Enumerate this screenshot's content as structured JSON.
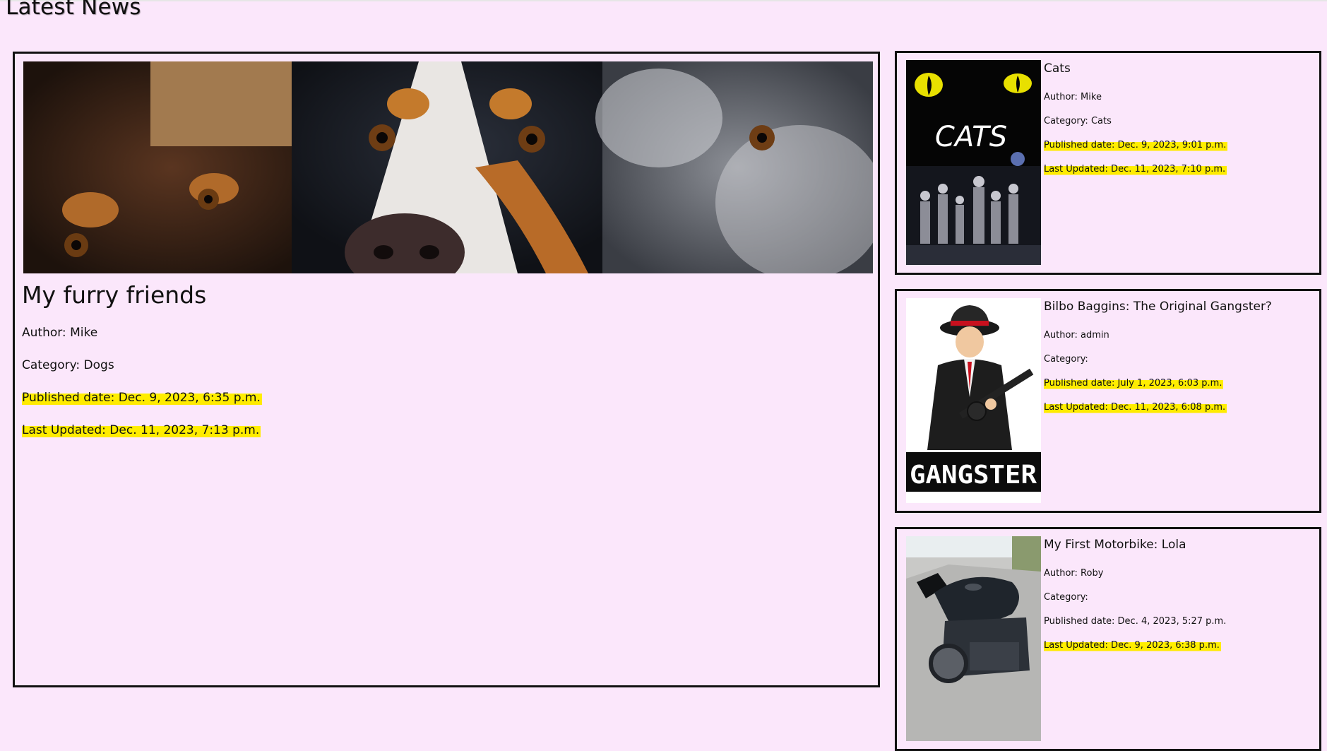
{
  "page": {
    "title": "Latest News",
    "highlight_color": "#ffea00",
    "background_color": "#fbe7fb"
  },
  "featured": {
    "image_icon": "dogs-photo",
    "title": "My furry friends",
    "author": "Author: Mike",
    "category": "Category: Dogs",
    "published": "Published date: Dec. 9, 2023, 6:35 p.m.",
    "updated": "Last Updated: Dec. 11, 2023, 7:13 p.m."
  },
  "cards": [
    {
      "image_icon": "cats-poster",
      "poster_text": "CATS",
      "title": "Cats",
      "author": "Author: Mike",
      "category": "Category: Cats",
      "published": "Published date: Dec. 9, 2023, 9:01 p.m.",
      "updated": "Last Updated: Dec. 11, 2023, 7:10 p.m."
    },
    {
      "image_icon": "gangster-illustration",
      "poster_text": "GANGSTER",
      "title": "Bilbo Baggins: The Original Gangster?",
      "author": "Author: admin",
      "category": "Category:",
      "published": "Published date: July 1, 2023, 6:03 p.m.",
      "updated": "Last Updated: Dec. 11, 2023, 6:08 p.m."
    },
    {
      "image_icon": "motorbike-photo",
      "title": "My First Motorbike: Lola",
      "author": "Author: Roby",
      "category": "Category:",
      "published": "Published date: Dec. 4, 2023, 5:27 p.m.",
      "updated": "Last Updated: Dec. 9, 2023, 6:38 p.m."
    }
  ]
}
